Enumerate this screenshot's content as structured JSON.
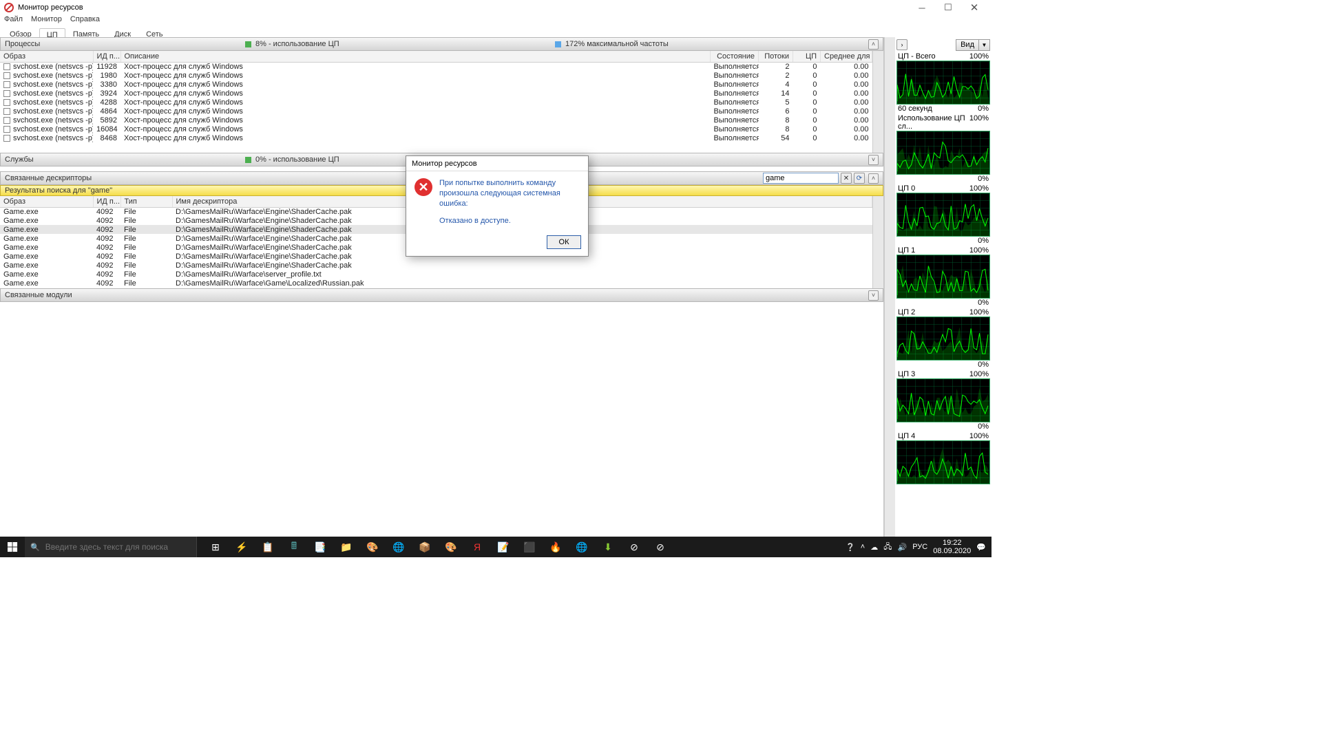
{
  "window": {
    "title": "Монитор ресурсов"
  },
  "menu": [
    "Файл",
    "Монитор",
    "Справка"
  ],
  "tabs": [
    "Обзор",
    "ЦП",
    "Память",
    "Диск",
    "Сеть"
  ],
  "active_tab": 1,
  "proc_bar": {
    "label": "Процессы",
    "cpu_label": "8% - использование ЦП",
    "freq_label": "172% максимальной частоты"
  },
  "proc_cols": [
    "Образ",
    "ИД п...",
    "Описание",
    "Состояние",
    "Потоки",
    "ЦП",
    "Среднее для ЦП"
  ],
  "proc_rows": [
    {
      "img": "svchost.exe (netsvcs -p)",
      "pid": "11928",
      "desc": "Хост-процесс для служб Windows",
      "st": "Выполняется",
      "th": "2",
      "cpu": "0",
      "avg": "0.00"
    },
    {
      "img": "svchost.exe (netsvcs -p)",
      "pid": "1980",
      "desc": "Хост-процесс для служб Windows",
      "st": "Выполняется",
      "th": "2",
      "cpu": "0",
      "avg": "0.00"
    },
    {
      "img": "svchost.exe (netsvcs -p)",
      "pid": "3380",
      "desc": "Хост-процесс для служб Windows",
      "st": "Выполняется",
      "th": "4",
      "cpu": "0",
      "avg": "0.00"
    },
    {
      "img": "svchost.exe (netsvcs -p)",
      "pid": "3924",
      "desc": "Хост-процесс для служб Windows",
      "st": "Выполняется",
      "th": "14",
      "cpu": "0",
      "avg": "0.00"
    },
    {
      "img": "svchost.exe (netsvcs -p)",
      "pid": "4288",
      "desc": "Хост-процесс для служб Windows",
      "st": "Выполняется",
      "th": "5",
      "cpu": "0",
      "avg": "0.00"
    },
    {
      "img": "svchost.exe (netsvcs -p)",
      "pid": "4864",
      "desc": "Хост-процесс для служб Windows",
      "st": "Выполняется",
      "th": "6",
      "cpu": "0",
      "avg": "0.00"
    },
    {
      "img": "svchost.exe (netsvcs -p)",
      "pid": "5892",
      "desc": "Хост-процесс для служб Windows",
      "st": "Выполняется",
      "th": "8",
      "cpu": "0",
      "avg": "0.00"
    },
    {
      "img": "svchost.exe (netsvcs -p)",
      "pid": "16084",
      "desc": "Хост-процесс для служб Windows",
      "st": "Выполняется",
      "th": "8",
      "cpu": "0",
      "avg": "0.00"
    },
    {
      "img": "svchost.exe (netsvcs -p)",
      "pid": "8468",
      "desc": "Хост-процесс для служб Windows",
      "st": "Выполняется",
      "th": "54",
      "cpu": "0",
      "avg": "0.00"
    }
  ],
  "svc_bar": {
    "label": "Службы",
    "cpu_label": "0% - использование ЦП"
  },
  "handles_bar": {
    "label": "Связанные дескрипторы",
    "search_value": "game"
  },
  "results_bar": {
    "label": "Результаты поиска для \"game\""
  },
  "handles_cols": [
    "Образ",
    "ИД п...",
    "Тип",
    "Имя дескриптора"
  ],
  "handles_rows": [
    {
      "img": "Game.exe",
      "pid": "4092",
      "type": "File",
      "name": "D:\\GamesMailRu\\Warface\\Engine\\ShaderCache.pak",
      "sel": false
    },
    {
      "img": "Game.exe",
      "pid": "4092",
      "type": "File",
      "name": "D:\\GamesMailRu\\Warface\\Engine\\ShaderCache.pak",
      "sel": false
    },
    {
      "img": "Game.exe",
      "pid": "4092",
      "type": "File",
      "name": "D:\\GamesMailRu\\Warface\\Engine\\ShaderCache.pak",
      "sel": true
    },
    {
      "img": "Game.exe",
      "pid": "4092",
      "type": "File",
      "name": "D:\\GamesMailRu\\Warface\\Engine\\ShaderCache.pak",
      "sel": false
    },
    {
      "img": "Game.exe",
      "pid": "4092",
      "type": "File",
      "name": "D:\\GamesMailRu\\Warface\\Engine\\ShaderCache.pak",
      "sel": false
    },
    {
      "img": "Game.exe",
      "pid": "4092",
      "type": "File",
      "name": "D:\\GamesMailRu\\Warface\\Engine\\ShaderCache.pak",
      "sel": false
    },
    {
      "img": "Game.exe",
      "pid": "4092",
      "type": "File",
      "name": "D:\\GamesMailRu\\Warface\\Engine\\ShaderCache.pak",
      "sel": false
    },
    {
      "img": "Game.exe",
      "pid": "4092",
      "type": "File",
      "name": "D:\\GamesMailRu\\Warface\\server_profile.txt",
      "sel": false
    },
    {
      "img": "Game.exe",
      "pid": "4092",
      "type": "File",
      "name": "D:\\GamesMailRu\\Warface\\Game\\Localized\\Russian.pak",
      "sel": false
    }
  ],
  "modules_bar": {
    "label": "Связанные модули"
  },
  "graphs_header": {
    "view": "Вид"
  },
  "graphs": [
    {
      "title": "ЦП - Всего",
      "pct": "100%",
      "sub_l": "60 секунд",
      "sub_r": "0%"
    },
    {
      "title": "Использование ЦП сл...",
      "pct": "100%",
      "sub_l": "",
      "sub_r": "0%"
    },
    {
      "title": "ЦП 0",
      "pct": "100%",
      "sub_l": "",
      "sub_r": "0%"
    },
    {
      "title": "ЦП 1",
      "pct": "100%",
      "sub_l": "",
      "sub_r": "0%"
    },
    {
      "title": "ЦП 2",
      "pct": "100%",
      "sub_l": "",
      "sub_r": "0%"
    },
    {
      "title": "ЦП 3",
      "pct": "100%",
      "sub_l": "",
      "sub_r": "0%"
    },
    {
      "title": "ЦП 4",
      "pct": "100%",
      "sub_l": "",
      "sub_r": ""
    }
  ],
  "dialog": {
    "title": "Монитор ресурсов",
    "line1": "При попытке выполнить команду произошла следующая системная ошибка:",
    "line2": "Отказано в доступе.",
    "ok": "ОК"
  },
  "taskbar": {
    "search_placeholder": "Введите здесь текст для поиска",
    "lang": "РУС",
    "time": "19:22",
    "date": "08.09.2020"
  }
}
